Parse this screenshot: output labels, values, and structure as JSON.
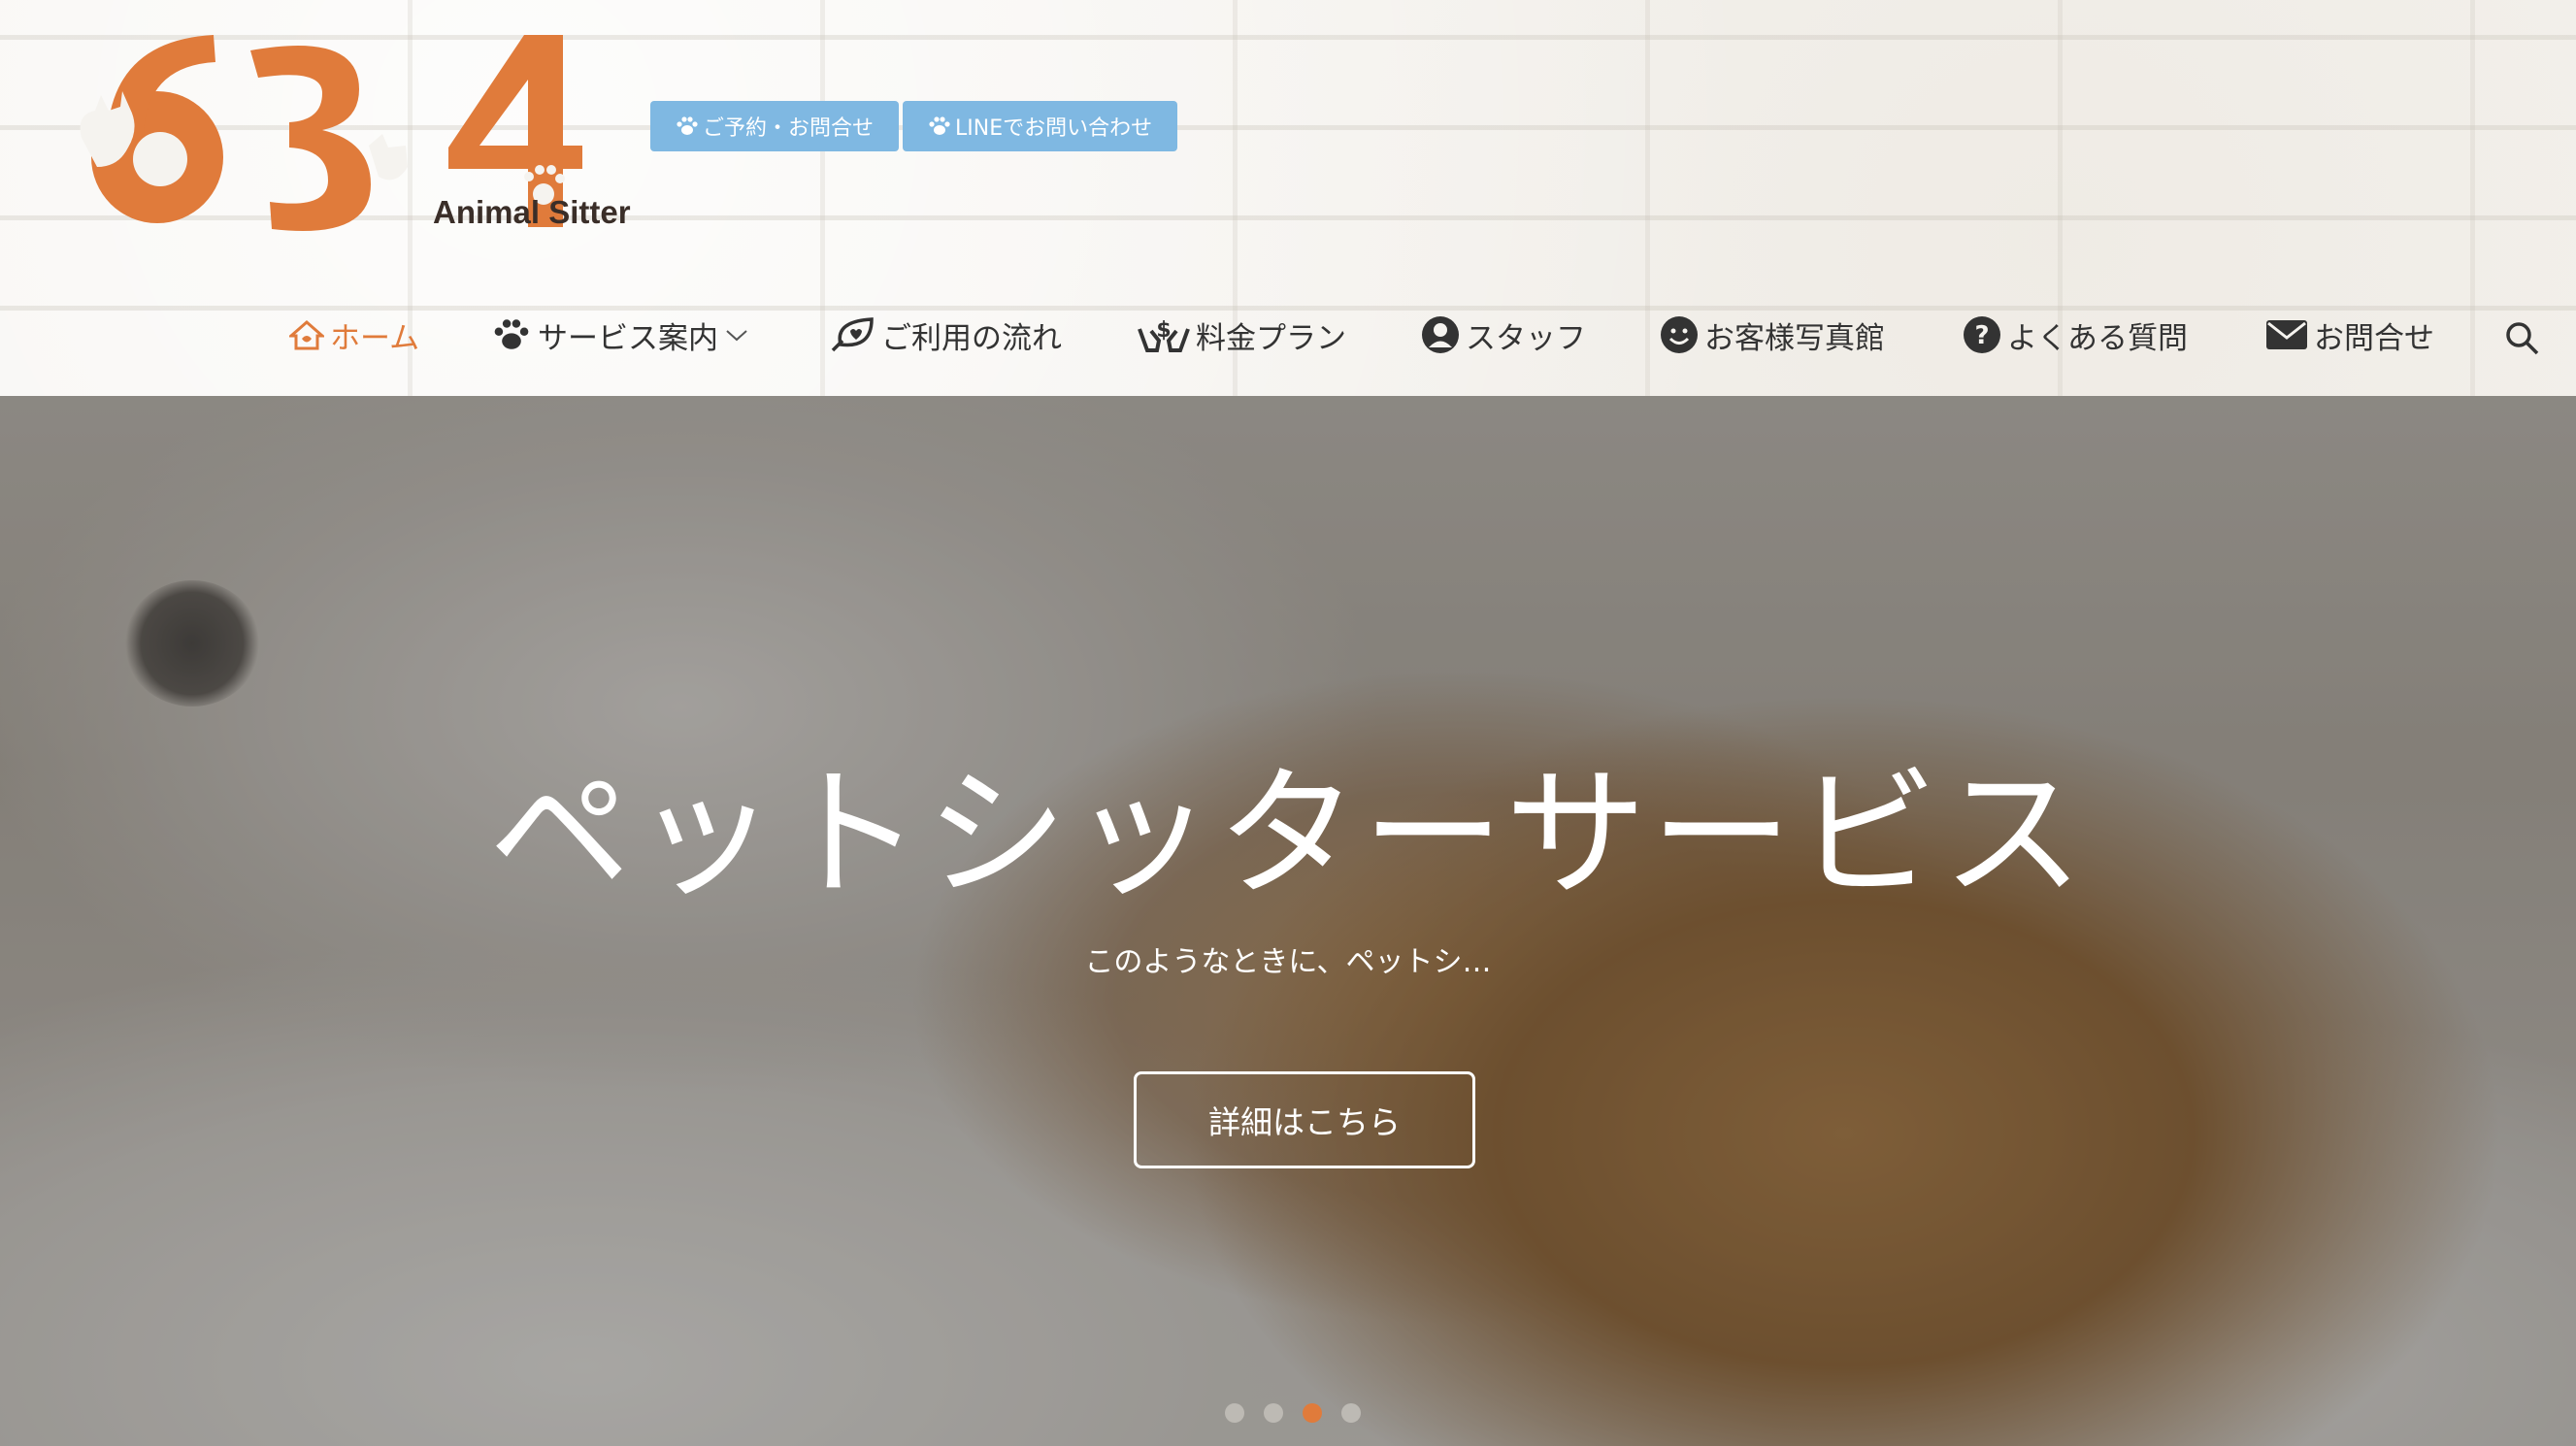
{
  "logo": {
    "number": "634",
    "caption": "Animal Sitter",
    "brand_color": "#e07b3b"
  },
  "top_buttons": [
    {
      "label": "ご予約・お問合せ",
      "icon": "paw-icon"
    },
    {
      "label": "LINEでお問い合わせ",
      "icon": "paw-icon"
    }
  ],
  "nav": {
    "items": [
      {
        "label": "ホーム",
        "icon": "home-icon",
        "active": true
      },
      {
        "label": "サービス案内",
        "icon": "paw-icon",
        "has_dropdown": true
      },
      {
        "label": "ご利用の流れ",
        "icon": "heart-leaf-icon"
      },
      {
        "label": "料金プラン",
        "icon": "money-hands-icon"
      },
      {
        "label": "スタッフ",
        "icon": "user-circle-icon"
      },
      {
        "label": "お客様写真館",
        "icon": "smile-icon"
      },
      {
        "label": "よくある質問",
        "icon": "question-icon"
      },
      {
        "label": "お問合せ",
        "icon": "envelope-icon"
      }
    ],
    "search_icon": "search-icon",
    "active_color": "#e07b3b"
  },
  "hero": {
    "title": "ペットシッターサービス",
    "subtitle": "このようなときに、ペットシ…",
    "button_label": "詳細はこちら",
    "slides": {
      "count": 4,
      "active_index": 2
    }
  }
}
